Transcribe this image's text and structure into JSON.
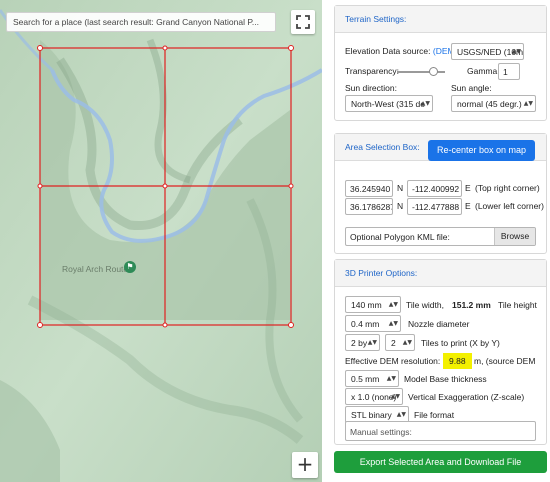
{
  "map": {
    "search_placeholder": "Search for a place (last search result: Grand Canyon National P...",
    "poi_label": "Royal Arch Route",
    "zoom_in_label": "+",
    "icons": [
      "fullscreen-icon",
      "hiking-poi-icon"
    ],
    "colors": {
      "selection_box": "#e02020",
      "river": "#9bbde6",
      "terrain": "#c6dcc6"
    }
  },
  "terrain": {
    "title": "Terrain Settings:",
    "elevation_label": "Elevation Data source:",
    "elevation_link": "(DEM",
    "elevation_value": "USGS/NED (10m...",
    "transparency_label": "Transparency:",
    "transparency_level": 0.75,
    "gamma_label": "Gamma:",
    "gamma_value": "1",
    "sun_direction_label": "Sun direction:",
    "sun_direction_value": "North-West (315 de",
    "sun_angle_label": "Sun angle:",
    "sun_angle_value": "normal (45 degr.)"
  },
  "area": {
    "title": "Area Selection Box:",
    "recenter_button": "Re-center box on map",
    "tr_lat": "36.245940",
    "tr_lat_dir": "N",
    "tr_lon": "-112.400992",
    "tr_lon_dir": "E",
    "tr_label": "(Top right corner)",
    "ll_lat": "36.1786287",
    "ll_lat_dir": "N",
    "ll_lon": "-112.477888",
    "ll_lon_dir": "E",
    "ll_label": "(Lower left corner)",
    "kml_placeholder": "Optional Polygon KML file:",
    "browse_button": "Browse"
  },
  "printer": {
    "title": "3D Printer Options:",
    "tile_width_value": "140 mm",
    "tile_width_label": "Tile width,",
    "tile_height_value": "151.2",
    "tile_height_unit": "mm",
    "tile_height_label": "Tile height",
    "nozzle_value": "0.4 mm",
    "nozzle_label": "Nozzle diameter",
    "tiles_x": "2 by",
    "tiles_y": "2",
    "tiles_label": "Tiles to print (X by Y)",
    "dem_res_label": "Effective DEM resolution:",
    "dem_res_value": "9.88",
    "dem_res_suffix": "m,  (source DEM",
    "base_value": "0.5 mm",
    "base_label": "Model Base thickness",
    "exag_value": "x 1.0 (none)",
    "exag_label": "Vertical Exaggeration (Z-scale)",
    "format_value": "STL binary",
    "format_label": "File format",
    "manual_placeholder": "Manual settings:"
  },
  "export_button": "Export Selected Area and Download File"
}
